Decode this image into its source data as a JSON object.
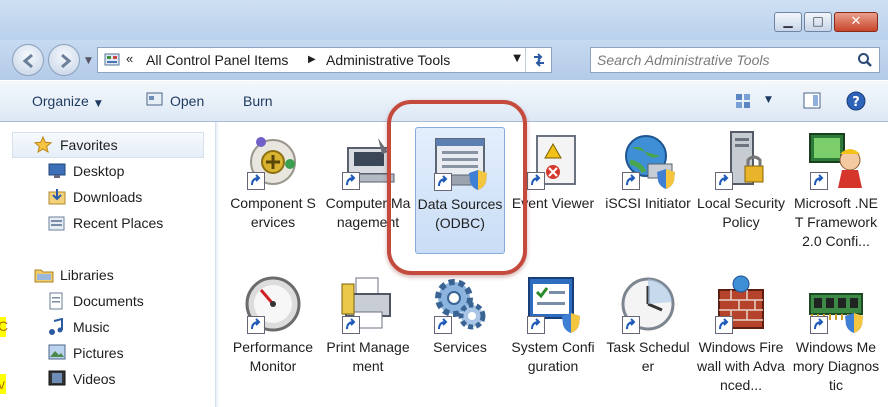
{
  "window": {
    "buttons": [
      "minimize",
      "maximize",
      "close"
    ]
  },
  "address": {
    "chevron": "«",
    "crumbs": [
      "All Control Panel Items",
      "Administrative Tools"
    ]
  },
  "search": {
    "placeholder": "Search Administrative Tools"
  },
  "toolbar": {
    "organize": "Organize",
    "open": "Open",
    "burn": "Burn"
  },
  "nav": {
    "favorites": "Favorites",
    "desktop": "Desktop",
    "downloads": "Downloads",
    "recent_places": "Recent Places",
    "libraries": "Libraries",
    "documents": "Documents",
    "music": "Music",
    "pictures": "Pictures",
    "videos": "Videos"
  },
  "tiles": [
    {
      "label": "Component Services",
      "icon": "component-services-icon"
    },
    {
      "label": "Computer Management",
      "icon": "computer-management-icon"
    },
    {
      "label": "Data Sources (ODBC)",
      "icon": "odbc-icon"
    },
    {
      "label": "Event Viewer",
      "icon": "event-viewer-icon"
    },
    {
      "label": "iSCSI Initiator",
      "icon": "iscsi-icon"
    },
    {
      "label": "Local Security Policy",
      "icon": "security-policy-icon"
    },
    {
      "label": "Microsoft .NET Framework 2.0 Confi...",
      "icon": "dotnet-icon"
    },
    {
      "label": "Performance Monitor",
      "icon": "performance-monitor-icon"
    },
    {
      "label": "Print Management",
      "icon": "print-management-icon"
    },
    {
      "label": "Services",
      "icon": "services-icon"
    },
    {
      "label": "System Configuration",
      "icon": "system-configuration-icon"
    },
    {
      "label": "Task Scheduler",
      "icon": "task-scheduler-icon"
    },
    {
      "label": "Windows Firewall with Advanced...",
      "icon": "firewall-icon"
    },
    {
      "label": "Windows Memory Diagnostic",
      "icon": "memory-diagnostic-icon"
    }
  ],
  "edge_text": {
    "a": "C",
    "b": "v"
  },
  "colors": {
    "highlight_ring": "#c44a3d",
    "selection": "#c9ddf6"
  }
}
